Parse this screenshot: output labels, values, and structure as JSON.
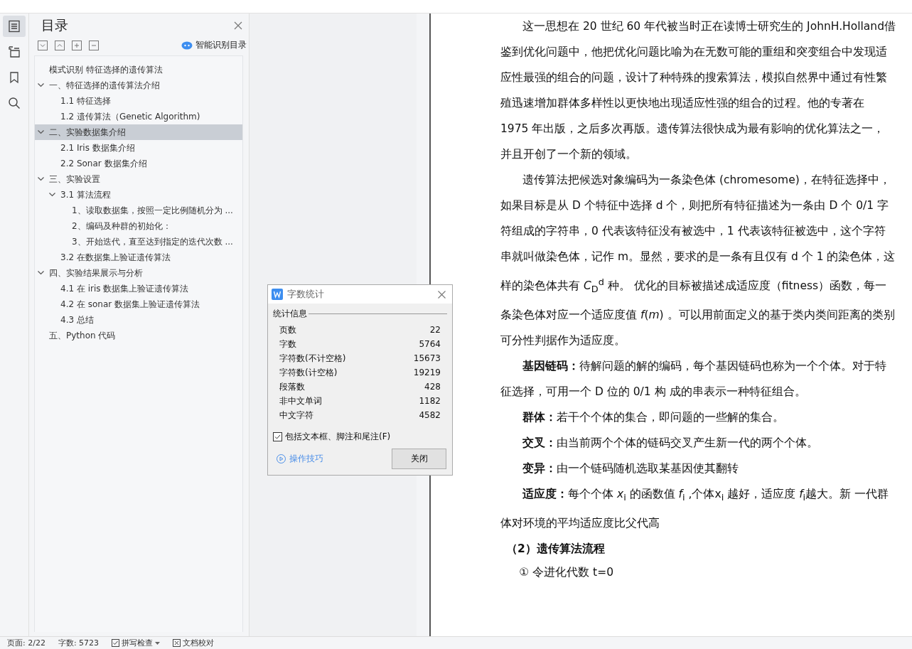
{
  "rail": [
    {
      "kind": "list",
      "selected": true
    },
    {
      "kind": "outline",
      "selected": false
    },
    {
      "kind": "bookmark",
      "selected": false
    },
    {
      "kind": "search",
      "selected": false
    }
  ],
  "toc": {
    "title": "目录",
    "smart_button": "智能识别目录",
    "items": [
      {
        "label": "模式识别  特征选择的遗传算法",
        "selected": false
      },
      {
        "label": "一、特征选择的遗传算法介绍",
        "selected": false,
        "expanded": true,
        "children": [
          {
            "label": "1.1  特征选择",
            "selected": false
          },
          {
            "label": "1.2  遗传算法（Genetic Algorithm)",
            "selected": false
          }
        ]
      },
      {
        "label": "二、实验数据集介绍",
        "selected": true,
        "expanded": true,
        "children": [
          {
            "label": "2.1 Iris 数据集介绍",
            "selected": false
          },
          {
            "label": "2.2 Sonar 数据集介绍",
            "selected": false
          }
        ]
      },
      {
        "label": "三、实验设置",
        "selected": false,
        "expanded": true,
        "children": [
          {
            "label": "3.1  算法流程",
            "selected": false,
            "expanded": true,
            "children": [
              {
                "label": "1、读取数据集，按照一定比例随机分为 ...",
                "selected": false
              },
              {
                "label": "2、编码及种群的初始化：",
                "selected": false
              },
              {
                "label": "3、开始迭代，直至达到指定的迭代次数 ...",
                "selected": false
              }
            ]
          },
          {
            "label": "3.2  在数据集上验证遗传算法",
            "selected": false
          }
        ]
      },
      {
        "label": "四、实验结果展示与分析",
        "selected": false,
        "expanded": true,
        "children": [
          {
            "label": "4.1  在 iris 数据集上验证遗传算法",
            "selected": false
          },
          {
            "label": "4.2  在 sonar 数据集上验证遗传算法",
            "selected": false
          },
          {
            "label": "4.3  总结",
            "selected": false
          }
        ]
      },
      {
        "label": "五、Python 代码",
        "selected": false
      }
    ]
  },
  "dialog": {
    "title": "字数统计",
    "group": "统计信息",
    "stats": [
      {
        "label": "页数",
        "value": "22"
      },
      {
        "label": "字数",
        "value": "5764"
      },
      {
        "label": "字符数(不计空格)",
        "value": "15673"
      },
      {
        "label": "字符数(计空格)",
        "value": "19219"
      },
      {
        "label": "段落数",
        "value": "428"
      },
      {
        "label": "非中文单词",
        "value": "1182"
      },
      {
        "label": "中文字符",
        "value": "4582"
      }
    ],
    "checkbox": {
      "label": "包括文本框、脚注和尾注(F)",
      "checked": true
    },
    "tips_link": "操作技巧",
    "close_button": "关闭"
  },
  "document": [
    {
      "kind": "para",
      "text": "这一思想在 20 世纪 60 年代被当时正在读博士研究生的 JohnH.Holland借鉴到优化问题中，他把优化问题比喻为在无数可能的重组和突变组合中发现适应性最强的组合的问题，设计了种特殊的搜索算法，模拟自然界中通过有性繁殖迅速增加群体多样性以更快地出现适应性强的组合的过程。他的专著在 1975 年出版，之后多次再版。遗传算法很快成为最有影响的优化算法之一，并且开创了一个新的领域。"
    },
    {
      "kind": "para",
      "text": "遗传算法把候选对象编码为一条染色体 (chromesome)，在特征选择中，如果目标是从 D 个特征中选择 d 个，则把所有特征描述为一条由 D 个 0/1 字符组成的字符串，0 代表该特征没有被选中，1 代表该特征被选中，这个字符串就叫做染色体，记作 m。显然，要求的是一条有且仅有 d 个 1 的染色体，这样的染色体共有 *C*$_{D}$$^{d}$ 种。 优化的目标被描述成适应度（fitness）函数，每一条染色体对应一个适应度值 *f*(*m*) 。可以用前面定义的基于类内类间距离的类别可分性判据作为适应度。"
    },
    {
      "kind": "para",
      "text": "**基因链码：**待解问题的解的编码，每个基因链码也称为一个个体。对于特征选择，可用一个 D 位的 0/1 构 成的串表示一种特征组合。"
    },
    {
      "kind": "para",
      "text": "**群体：**若干个个体的集合，即问题的一些解的集合。"
    },
    {
      "kind": "para",
      "text": "**交叉：**由当前两个个体的链码交叉产生新一代的两个个体。"
    },
    {
      "kind": "para",
      "text": "**变异：**由一个链码随机选取某基因使其翻转"
    },
    {
      "kind": "para",
      "text": "**适应度：**每个个体 *x*$_{i}$ 的函数值 *f*$_{i}$ ,个体x$_{i}$ 越好，适应度 *f*$_{i}$越大。新 一代群体对环境的平均适应度比父代高"
    },
    {
      "kind": "heading",
      "text": "（2）遗传算法流程"
    },
    {
      "kind": "step",
      "text": "① 令进化代数 t=0"
    }
  ],
  "status_bar": [
    {
      "kind": "text",
      "label": "页面: 2/22"
    },
    {
      "kind": "text",
      "label": "字数: 5723"
    },
    {
      "kind": "check",
      "label": "拼写检查",
      "checked": true,
      "dropdown": true
    },
    {
      "kind": "check",
      "label": "文档校对",
      "checked": false
    }
  ]
}
